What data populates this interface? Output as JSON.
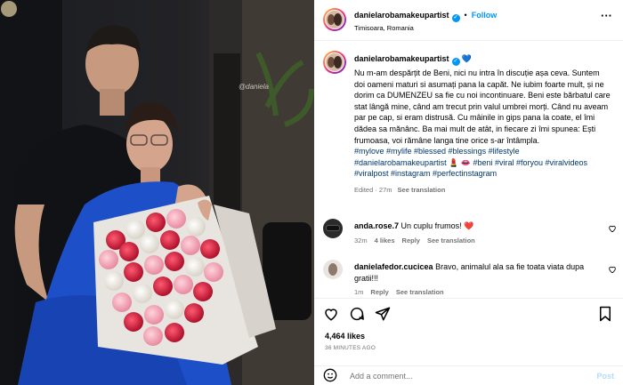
{
  "post": {
    "photo_watermark": "@daniela",
    "header": {
      "username": "danielarobamakeupartist",
      "follow_label": "Follow",
      "location": "Timisoara, Romania",
      "more_label": "···"
    },
    "caption": {
      "username": "danielarobamakeupartist",
      "text": "Nu m-am despărțit de Beni, nici nu intra în discuție așa ceva. Suntem doi oameni maturi si asumați pana la capăt. Ne iubim foarte mult, și ne dorim ca DUMENZEU sa fie cu noi incontinuare. Beni este bărbatul care stat lângă mine, când am trecut prin valul umbrei morți. Când nu aveam par pe cap, si eram distrusă. Cu mâinile in gips pana la coate, el îmi dădea sa mănânc. Ba mai mult de atât, in fiecare zi îmi spunea: Ești frumoasa, voi rămâne langa tine orice s-ar întâmpla.",
      "hashtags": "#mylove #mylife #blessed #blessings #lifestyle #danielarobamakeupartist 💄 👄 #beni #viral #foryou #viralvideos #viralpost #instagram #perfectinstagram",
      "edited": "Edited · 27m",
      "see_translation": "See translation"
    },
    "comments": [
      {
        "username": "anda.rose.7",
        "text": "Un cuplu frumos! ❤️",
        "time": "32m",
        "likes": "4 likes",
        "reply": "Reply",
        "see_translation": "See translation"
      },
      {
        "username": "danielafedor.cucicea",
        "text": "Bravo, animalul ala sa fie toata viata dupa gratii!!!",
        "time": "1m",
        "likes": "",
        "reply": "Reply",
        "see_translation": "See translation"
      }
    ],
    "likes_count": "4,464 likes",
    "time_ago": "36 MINUTES AGO",
    "add_comment_placeholder": "Add a comment...",
    "post_label": "Post"
  },
  "colors": {
    "accent": "#0095f6",
    "hashtag": "#00376b",
    "muted": "#737373",
    "dress": "#1d4fc9"
  },
  "icons": [
    "verified-icon",
    "more-icon",
    "heart-icon",
    "comment-icon",
    "share-icon",
    "bookmark-icon",
    "emoji-icon"
  ]
}
